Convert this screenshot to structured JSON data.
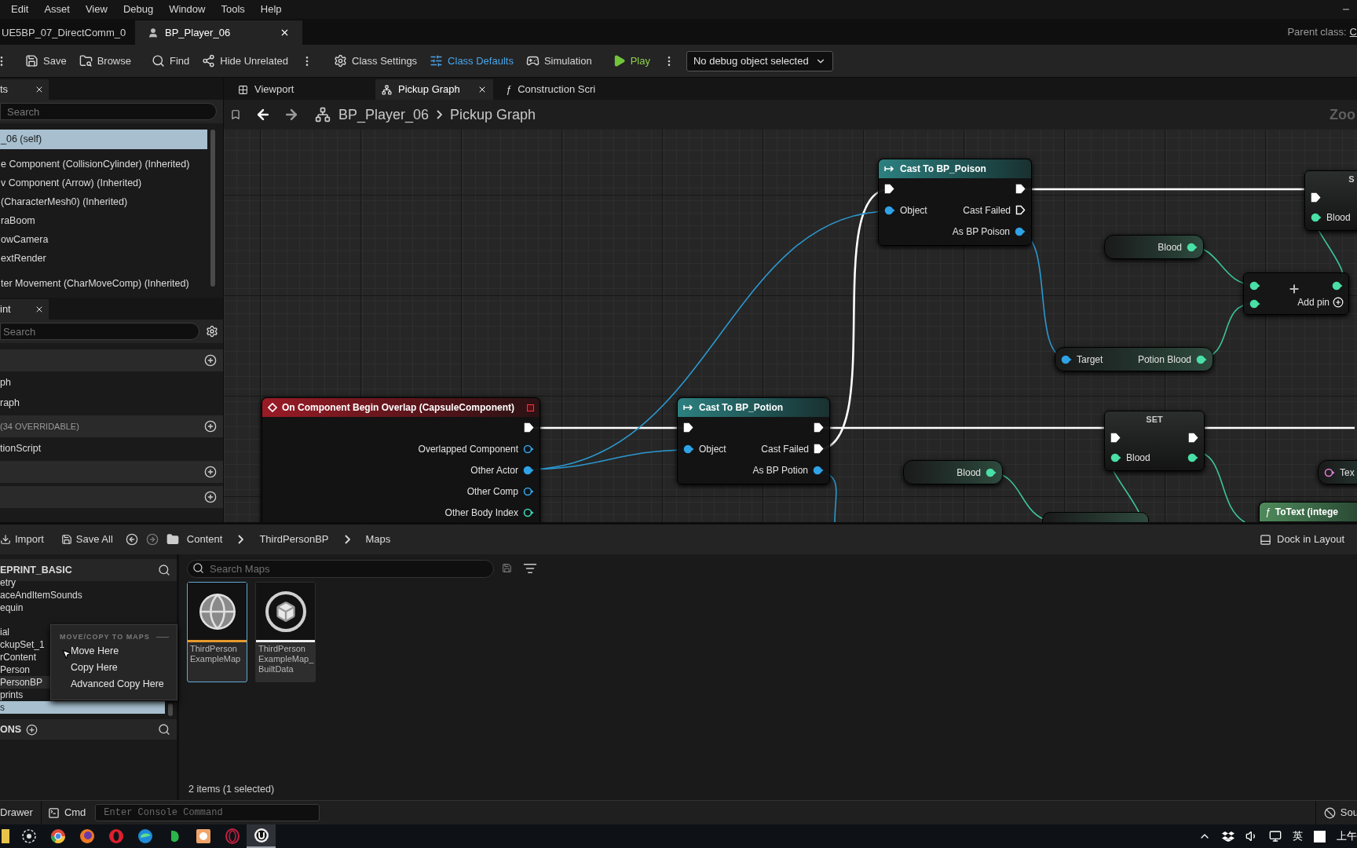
{
  "menu_bar": {
    "items": [
      "Edit",
      "Asset",
      "View",
      "Debug",
      "Window",
      "Tools",
      "Help"
    ]
  },
  "document_tabs": [
    {
      "label": "UE5BP_07_DirectComm_0",
      "selected": false,
      "closable": false
    },
    {
      "label": "BP_Player_06",
      "selected": true,
      "closable": true
    }
  ],
  "parent_class": {
    "label": "Parent class:",
    "value": "C"
  },
  "toolbar": [
    {
      "kind": "more",
      "selected": false
    },
    {
      "kind": "button",
      "label": "Save",
      "selected": false
    },
    {
      "kind": "button",
      "label": "Browse",
      "selected": false
    },
    {
      "kind": "button",
      "label": "Find",
      "selected": false
    },
    {
      "kind": "button",
      "label": "Hide Unrelated",
      "selected": false
    },
    {
      "kind": "more",
      "selected": false
    },
    {
      "kind": "button",
      "label": "Class Settings",
      "selected": false
    },
    {
      "kind": "button",
      "label": "Class Defaults",
      "selected": true
    },
    {
      "kind": "button",
      "label": "Simulation",
      "selected": false
    },
    {
      "kind": "play",
      "label": "Play",
      "selected": false
    },
    {
      "kind": "more",
      "selected": false
    },
    {
      "kind": "dropdown",
      "label": "No debug object selected",
      "selected": false
    }
  ],
  "components_panel": {
    "tab": "ts",
    "search_placeholder": "Search",
    "items": [
      {
        "label": "_06 (self)",
        "selected": true
      },
      {
        "label": "e Component (CollisionCylinder) (Inherited)",
        "selected": false
      },
      {
        "label": "v Component (Arrow) (Inherited)",
        "selected": false
      },
      {
        "label": "(CharacterMesh0) (Inherited)",
        "selected": false
      },
      {
        "label": "raBoom",
        "selected": false
      },
      {
        "label": "owCamera",
        "selected": false
      },
      {
        "label": "extRender",
        "selected": false
      },
      {
        "label": "ter Movement (CharMoveComp) (Inherited)",
        "selected": false
      }
    ]
  },
  "my_blueprint_panel": {
    "tab": "int",
    "search_placeholder": "Search",
    "rows": [
      {
        "kind": "header"
      },
      {
        "kind": "item",
        "label": "ph"
      },
      {
        "kind": "item",
        "label": "raph"
      },
      {
        "kind": "header",
        "label": "(34 OVERRIDABLE)"
      },
      {
        "kind": "item",
        "label": "tionScript"
      },
      {
        "kind": "header"
      },
      {
        "kind": "header"
      }
    ]
  },
  "graph_tabs": [
    {
      "label": "Viewport",
      "selected": false,
      "closable": false
    },
    {
      "label": "Pickup Graph",
      "selected": true,
      "closable": true
    },
    {
      "label": "Construction Scri",
      "glyph": "ƒ",
      "selected": false,
      "closable": false
    }
  ],
  "breadcrumb": [
    "BP_Player_06",
    "Pickup Graph"
  ],
  "zoom_label": "Zoo",
  "nodes": [
    {
      "kind": "event",
      "title": "On Component Begin Overlap (CapsuleComponent)",
      "rows": [
        {
          "right": {
            "kind": "exec",
            "connected": true
          }
        },
        {
          "right": {
            "label": "Overlapped Component",
            "kind": "object",
            "connected": false
          }
        },
        {
          "right": {
            "label": "Other Actor",
            "kind": "object",
            "connected": true
          }
        },
        {
          "right": {
            "label": "Other Comp",
            "kind": "object",
            "connected": false
          }
        },
        {
          "right": {
            "label": "Other Body Index",
            "kind": "int",
            "connected": false
          }
        }
      ]
    },
    {
      "kind": "cast",
      "title": "Cast To BP_Poison",
      "rows": [
        {
          "left": {
            "kind": "exec",
            "connected": true
          },
          "right": {
            "kind": "exec",
            "connected": true
          }
        },
        {
          "left": {
            "label": "Object",
            "kind": "object",
            "connected": true
          },
          "right": {
            "label": "Cast Failed",
            "kind": "exec",
            "connected": false
          }
        },
        {
          "right": {
            "label": "As BP Poison",
            "kind": "object",
            "connected": true
          }
        }
      ]
    },
    {
      "kind": "cast",
      "title": "Cast To BP_Potion",
      "rows": [
        {
          "left": {
            "kind": "exec",
            "connected": true
          },
          "right": {
            "kind": "exec",
            "connected": true
          }
        },
        {
          "left": {
            "label": "Object",
            "kind": "object",
            "connected": true
          },
          "right": {
            "label": "Cast Failed",
            "kind": "exec",
            "connected": true
          }
        },
        {
          "right": {
            "label": "As BP Potion",
            "kind": "object",
            "connected": true
          }
        }
      ]
    },
    {
      "kind": "getter",
      "rows": [
        {
          "right": {
            "label": "Blood",
            "kind": "float",
            "connected": true
          }
        }
      ]
    },
    {
      "kind": "add",
      "footer": "Add pin",
      "rows": [
        {
          "left": {
            "kind": "float",
            "connected": true
          },
          "right": {
            "kind": "float",
            "connected": true
          }
        },
        {
          "left": {
            "kind": "float",
            "connected": true
          }
        }
      ]
    },
    {
      "kind": "getter",
      "rows": [
        {
          "left": {
            "label": "Target",
            "kind": "object",
            "connected": true
          },
          "right": {
            "label": "Potion Blood",
            "kind": "float",
            "connected": true
          }
        }
      ]
    },
    {
      "kind": "set",
      "title": "SET",
      "rows": [
        {
          "left": {
            "kind": "exec",
            "connected": true
          },
          "right": {
            "kind": "exec",
            "connected": true
          }
        },
        {
          "left": {
            "label": "Blood",
            "kind": "float",
            "connected": true
          },
          "right": {
            "kind": "float",
            "connected": true
          }
        }
      ]
    },
    {
      "kind": "getter",
      "rows": [
        {
          "right": {
            "label": "Blood",
            "kind": "float",
            "connected": true
          }
        }
      ]
    },
    {
      "kind": "set",
      "title": "S",
      "rows": [
        {
          "left": {
            "kind": "exec",
            "connected": true
          }
        },
        {
          "left": {
            "label": "Blood",
            "kind": "float",
            "connected": true
          }
        }
      ]
    },
    {
      "kind": "getter",
      "rows": [
        {
          "left": {
            "label": "Tex",
            "kind": "text",
            "connected": false
          }
        }
      ]
    },
    {
      "kind": "function",
      "glyph": "ƒ",
      "title": "ToText (intege"
    },
    {
      "kind": "plain"
    }
  ],
  "content_browser": {
    "import": "Import",
    "save_all": "Save All",
    "path": [
      "Content",
      "ThirdPersonBP",
      "Maps"
    ],
    "dock": "Dock in Layout",
    "tree": {
      "header": "EPRINT_BASIC",
      "items": [
        {
          "label": "etry",
          "selected": false,
          "highlighted": false
        },
        {
          "label": "aceAndItemSounds",
          "selected": false,
          "highlighted": false
        },
        {
          "label": "equin",
          "selected": false,
          "highlighted": false
        },
        {
          "label": "ial",
          "selected": false,
          "highlighted": false
        },
        {
          "label": "ckupSet_1",
          "selected": false,
          "highlighted": false
        },
        {
          "label": "rContent",
          "selected": false,
          "highlighted": false
        },
        {
          "label": "Person",
          "selected": false,
          "highlighted": false
        },
        {
          "label": "PersonBP",
          "selected": false,
          "highlighted": true
        },
        {
          "label": "prints",
          "selected": false,
          "highlighted": false
        },
        {
          "label": "s",
          "selected": true,
          "highlighted": false
        }
      ],
      "footer": "ONS"
    },
    "context_menu": {
      "heading": "MOVE/COPY TO MAPS",
      "items": [
        "Move Here",
        "Copy Here",
        "Advanced Copy Here"
      ]
    },
    "search_placeholder": "Search Maps",
    "assets": [
      {
        "kind": "world",
        "label_lines": [
          "ThirdPerson",
          "ExampleMap"
        ],
        "selected": true
      },
      {
        "kind": "data",
        "label_lines": [
          "ThirdPerson",
          "ExampleMap_",
          "BuiltData"
        ],
        "selected": false
      }
    ],
    "status": "2 items (1 selected)"
  },
  "status_bar": {
    "drawer": "Drawer",
    "cmd": "Cmd",
    "console_placeholder": "Enter Console Command",
    "source": "Sou"
  },
  "taskbar": {
    "apps": [
      {
        "kind": "folder",
        "selected": false
      },
      {
        "kind": "flower",
        "selected": false
      },
      {
        "kind": "round_multicolor",
        "selected": false
      },
      {
        "kind": "round_orange",
        "selected": false
      },
      {
        "kind": "round_red",
        "selected": false
      },
      {
        "kind": "round_blue",
        "selected": false
      },
      {
        "kind": "leaf",
        "selected": false
      },
      {
        "kind": "square_orange",
        "selected": false
      },
      {
        "kind": "ring_red",
        "selected": false
      },
      {
        "kind": "round_white",
        "selected": true
      }
    ],
    "ime": "英",
    "clock": "上午"
  }
}
